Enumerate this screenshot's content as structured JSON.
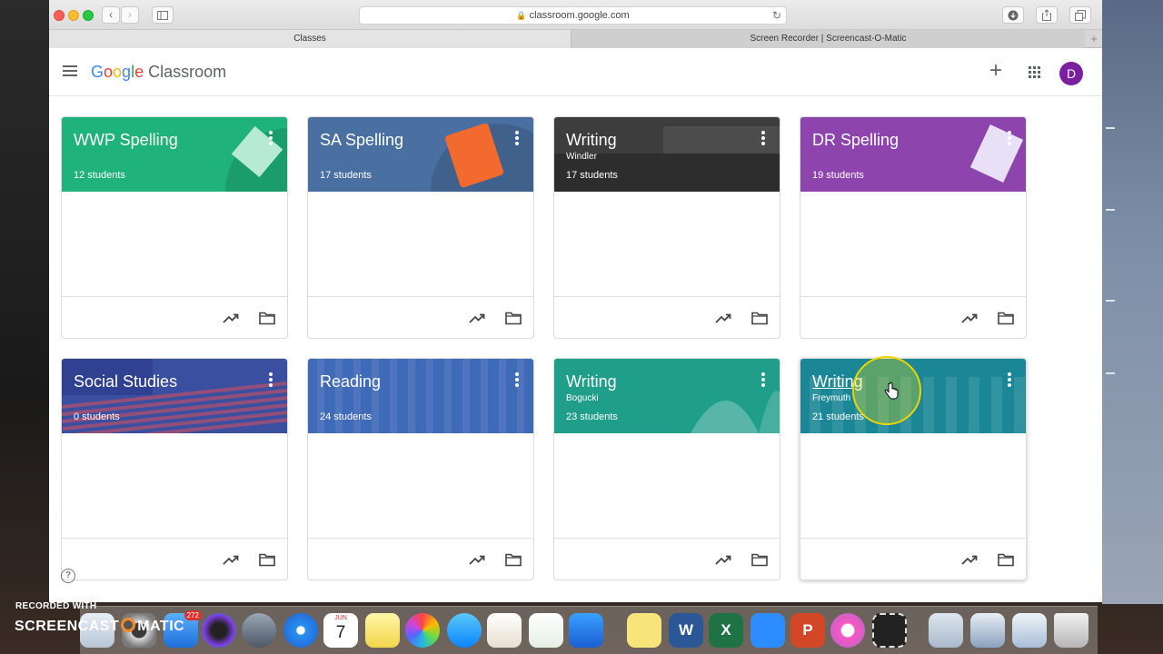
{
  "browser": {
    "url": "classroom.google.com",
    "tabs": [
      {
        "label": "Classes",
        "active": true
      },
      {
        "label": "Screen Recorder | Screencast-O-Matic",
        "active": false
      }
    ],
    "new_tab_label": "+"
  },
  "app": {
    "logo_google": [
      "G",
      "o",
      "o",
      "g",
      "l",
      "e"
    ],
    "logo_product": "Classroom",
    "create_label": "+",
    "avatar_initial": "D"
  },
  "classes": [
    {
      "title": "WWP Spelling",
      "section": "",
      "students": "12 students",
      "banner_color": "#1fb27a"
    },
    {
      "title": "SA Spelling",
      "section": "",
      "students": "17 students",
      "banner_color": "#4a6fa1"
    },
    {
      "title": "Writing",
      "section": "Windler",
      "students": "17 students",
      "banner_color": "#3d3d3d"
    },
    {
      "title": "DR Spelling",
      "section": "",
      "students": "19 students",
      "banner_color": "#8e44ad"
    },
    {
      "title": "Social Studies",
      "section": "",
      "students": "0 students",
      "banner_color": "#3b4fa0"
    },
    {
      "title": "Reading",
      "section": "",
      "students": "24 students",
      "banner_color": "#3f6ab8"
    },
    {
      "title": "Writing",
      "section": "Bogucki",
      "students": "23 students",
      "banner_color": "#1f9e8a"
    },
    {
      "title": "Writing",
      "section": "Freymuth",
      "students": "21 students",
      "banner_color": "#1b8796"
    }
  ],
  "help_label": "?",
  "dock": {
    "mail_badge": "272",
    "calendar_month": "JUN",
    "calendar_day": "7"
  },
  "watermark": {
    "line1": "RECORDED WITH",
    "brand_left": "SCREENCAST",
    "brand_right": "MATIC"
  }
}
